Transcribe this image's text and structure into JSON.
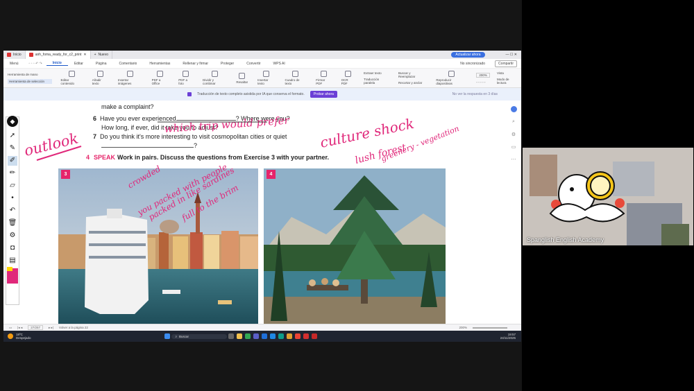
{
  "browser": {
    "tabs": [
      {
        "label": "Inicio",
        "color": "#d33"
      },
      {
        "label": "anh_foma_ready_for_c2_print",
        "color": "#d33"
      },
      {
        "label": "Nuevo",
        "color": "#666"
      }
    ],
    "update_button": "Actualizar ahora",
    "not_synced": "No sincronizado",
    "compartir": "Compartir"
  },
  "menubar": {
    "items": [
      "Menú",
      "Inicio",
      "Editar",
      "Página",
      "Comentario",
      "Herramientas",
      "Rellenar y firmar",
      "Proteger",
      "Convertir",
      "WPS AI"
    ],
    "active": "Inicio"
  },
  "ribbon": {
    "left_tools": [
      "Herramienta de mano",
      "Herramienta de selección"
    ],
    "buttons": [
      "Editar contenido",
      "Añadir texto",
      "Insertar imágenes",
      "PDF a Office",
      "PDF a foto",
      "Dividir y combinar",
      "Resaltar",
      "Insertar texto",
      "Cuadro de texto",
      "Firmar PDF",
      "OCR PDF",
      "Extraer texto",
      "Traducción paralela",
      "Buscar y Reemplazar",
      "Recortar y anclar",
      "Reproducir diapositivas"
    ],
    "zoom": "200%",
    "view_label": "Vista",
    "reading_mode": "Modo de lectura"
  },
  "notice": {
    "text": "Traducción de texto completo asistida por IA que conserva el formato.",
    "button": "Probar ahora",
    "right": "No ver la respuesta en 3 días"
  },
  "document": {
    "line0": "make a complaint?",
    "q6_num": "6",
    "q6_a": "Have you ever experienced",
    "q6_b": "? Where were you?",
    "q6_c": "How long, if ever, did it take you to adjust?",
    "q7_num": "7",
    "q7": "Do you think it's more interesting to visit cosmopolitan cities or quiet",
    "q7_end": "?",
    "speak_num": "4",
    "speak_label": "SPEAK",
    "speak_text": "Work in pairs. Discuss the questions from Exercise 3 with your partner.",
    "photo_labels": [
      "3",
      "4"
    ]
  },
  "annotations": {
    "outlook": "outlook",
    "which_trip": "which trip would prefer",
    "culture_shock": "culture shock",
    "lush_forest": "lush forest",
    "greenery": "greenery - vegetation",
    "crowded": "crowded",
    "packed1": "you packed with people",
    "packed2": "packed in like sardines",
    "full": "full to the brim",
    "colors": {
      "ink": "#e0287a"
    }
  },
  "statusbar": {
    "page": "27/257",
    "goto": "Volver a la página 22",
    "zoom": "200%"
  },
  "taskbar": {
    "weather_temp": "18ºC",
    "weather_desc": "Despejado",
    "search_placeholder": "Buscar",
    "time": "19:57",
    "date": "24/11/2025"
  },
  "webcam": {
    "name": "Spanglish English Academy"
  }
}
